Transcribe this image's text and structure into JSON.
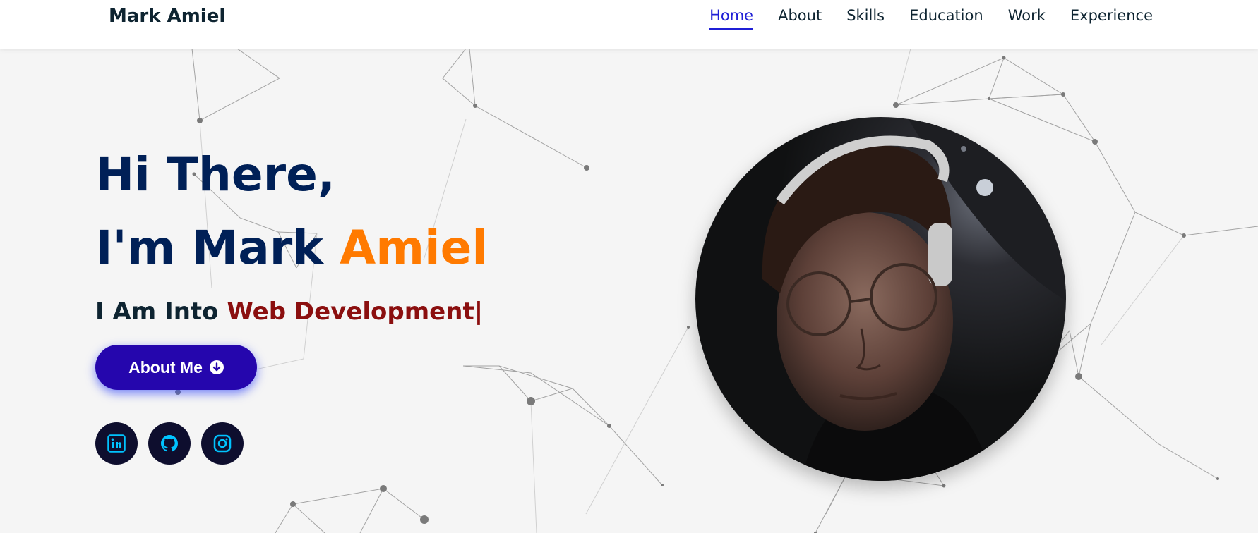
{
  "nav": {
    "brand": "Mark Amiel",
    "links": [
      "Home",
      "About",
      "Skills",
      "Education",
      "Work",
      "Experience"
    ],
    "active": "Home"
  },
  "hero": {
    "greeting_line1": "Hi There,",
    "greeting_line2_prefix": "I'm Mark ",
    "greeting_line2_accent": "Amiel",
    "tagline_prefix": "I Am Into ",
    "tagline_typed": "Web Development",
    "cursor": "|",
    "button_label": "About Me",
    "button_icon": "arrow-down-circle-icon"
  },
  "socials": [
    {
      "name": "linkedin",
      "icon": "linkedin-icon"
    },
    {
      "name": "github",
      "icon": "github-icon"
    },
    {
      "name": "instagram",
      "icon": "instagram-icon"
    }
  ],
  "colors": {
    "brand_text": "#0e2431",
    "heading": "#002057",
    "accent_orange": "#ff7a00",
    "typed_red": "#8b0f0f",
    "button": "#2506ad",
    "nav_active": "#1f1fd6",
    "social_bg": "#0e0e2e",
    "social_icon": "#00c3ff"
  }
}
